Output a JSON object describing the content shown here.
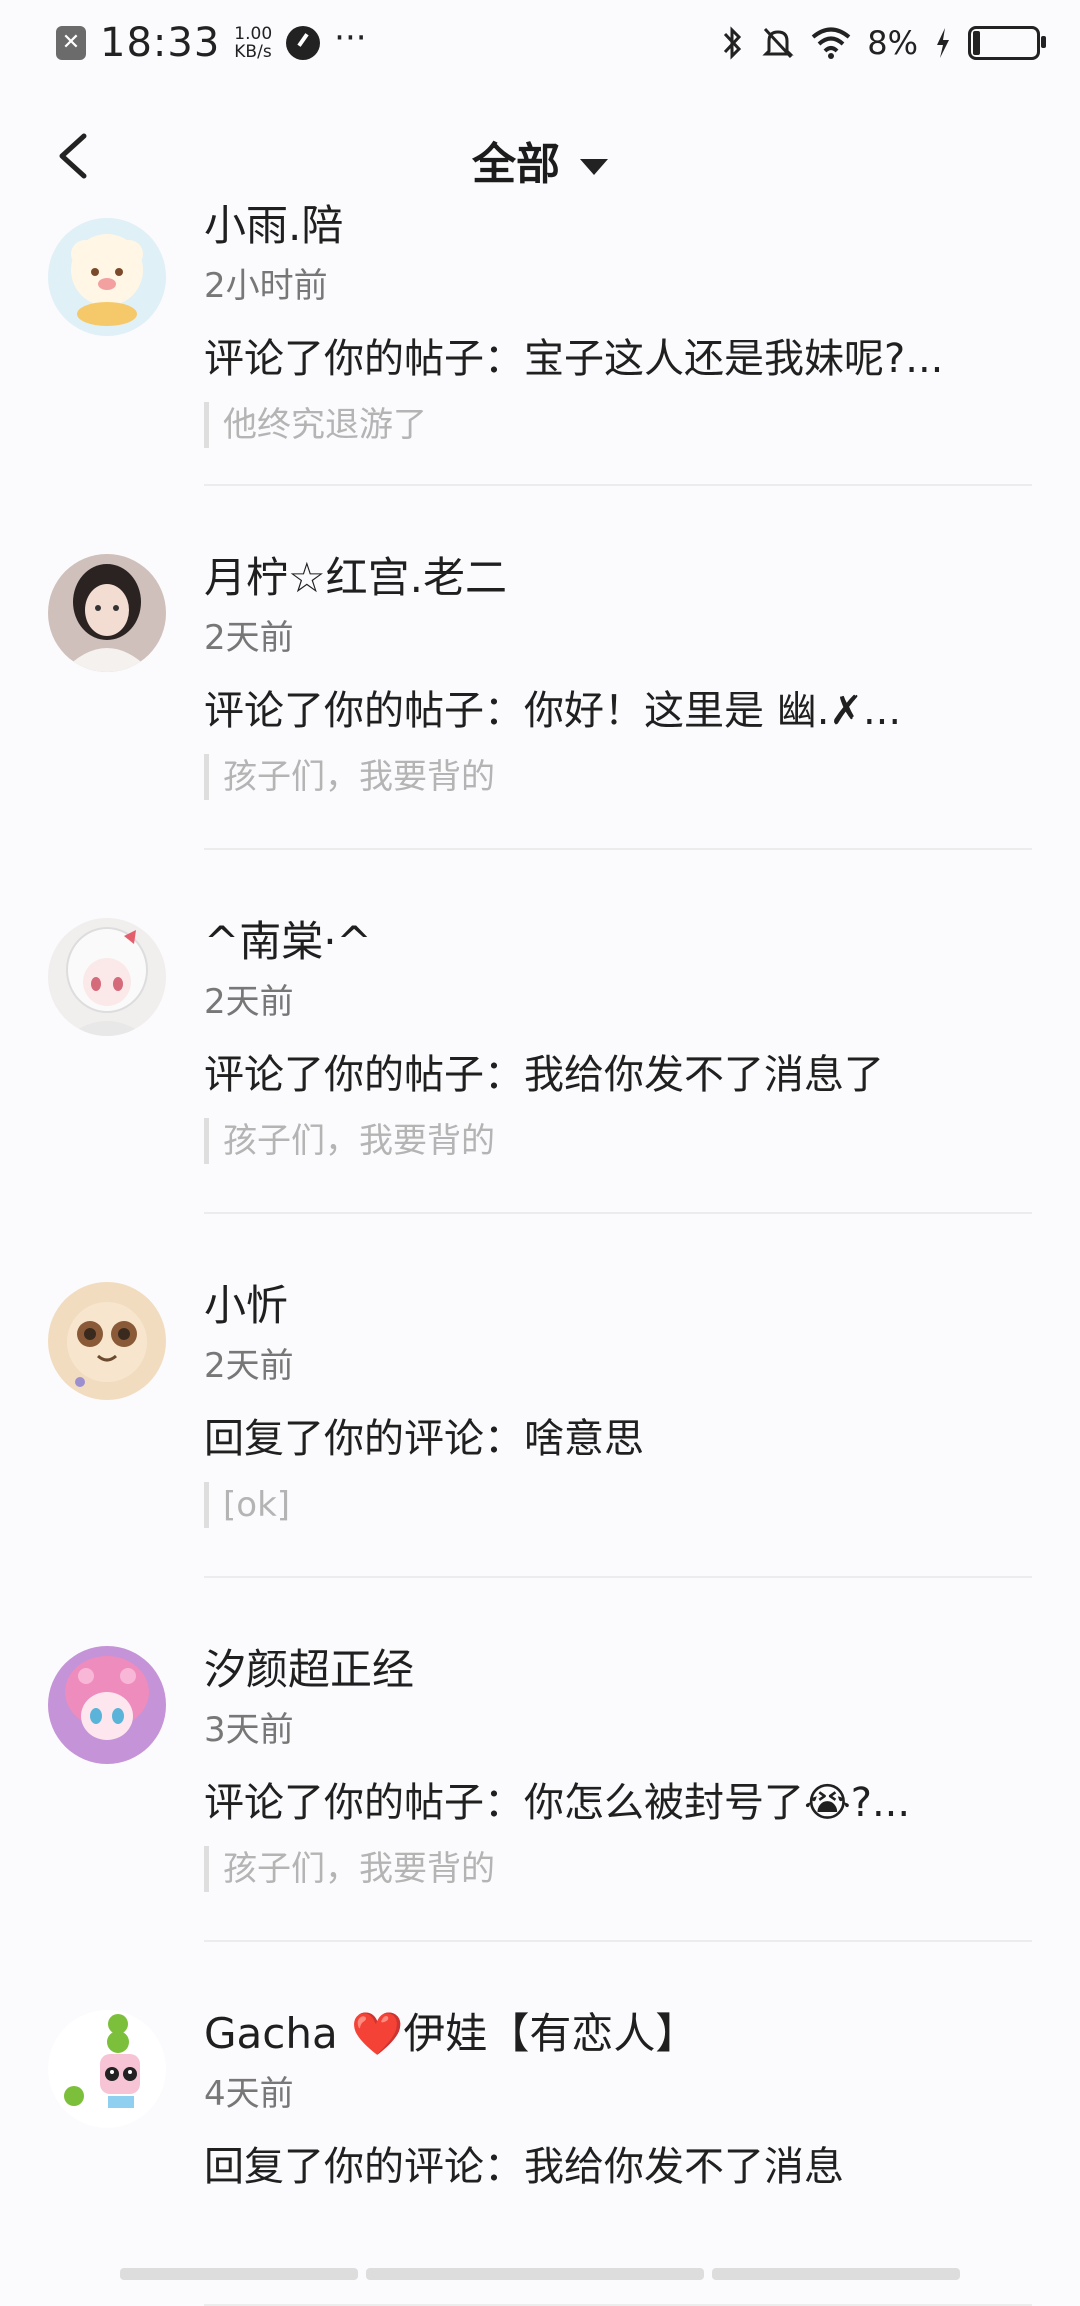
{
  "status": {
    "time": "18:33",
    "speed_value": "1.00",
    "speed_unit": "KB/s",
    "more": "···",
    "battery": "8%",
    "battery_level": 0.08
  },
  "header": {
    "title": "全部",
    "back_icon": "chevron-left-icon"
  },
  "items": [
    {
      "name": "小雨.陪",
      "time": "2小时前",
      "content": "评论了你的帖子：宝子这人还是我妹呢?...",
      "quote": "他终究退游了",
      "avatar_color": "#f6e7c7"
    },
    {
      "name": "月柠☆红宫.老二",
      "time": "2天前",
      "content": "评论了你的帖子：你好！这里是 幽.✗...",
      "quote": "孩子们，我要背的",
      "avatar_color": "#d9c6bd"
    },
    {
      "name": "^南棠·^",
      "time": "2天前",
      "content": "评论了你的帖子：我给你发不了消息了",
      "quote": "孩子们，我要背的",
      "avatar_color": "#eeeaea"
    },
    {
      "name": "小忻",
      "time": "2天前",
      "content": "回复了你的评论：啥意思",
      "quote": "[ok]",
      "avatar_color": "#f2d9b8"
    },
    {
      "name": "汐颜超正经",
      "time": "3天前",
      "content": "评论了你的帖子：你怎么被封号了😭?...",
      "quote": "孩子们，我要背的",
      "avatar_color": "#f2a9cf"
    },
    {
      "name": "Gacha ❤️伊娃【有恋人】",
      "time": "4天前",
      "content": "回复了你的评论：我给你发不了消息",
      "quote": "",
      "avatar_color": "#ffffff"
    }
  ]
}
